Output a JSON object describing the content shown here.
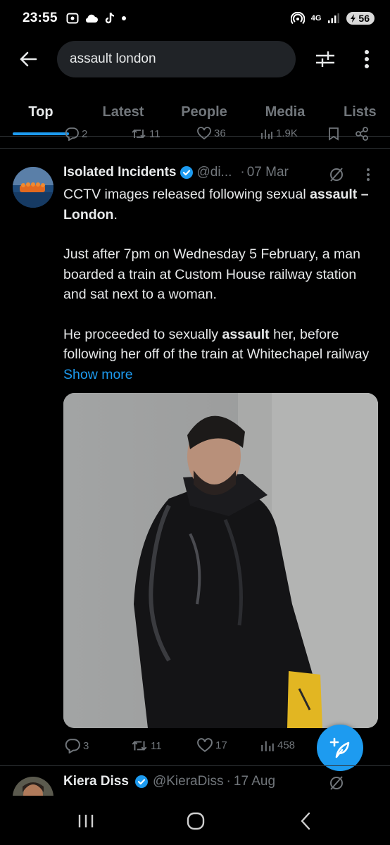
{
  "status_bar": {
    "time": "23:55",
    "network": "4G",
    "battery": "56",
    "left_icons": [
      "screen-record-icon",
      "cloud-icon",
      "tiktok-icon",
      "dot-icon"
    ],
    "right_icons": [
      "hotspot-icon",
      "signal-icon",
      "battery-icon"
    ]
  },
  "header": {
    "search_value": "assault london"
  },
  "tabs": [
    {
      "label": "Top",
      "active": true
    },
    {
      "label": "Latest",
      "active": false
    },
    {
      "label": "People",
      "active": false
    },
    {
      "label": "Media",
      "active": false
    },
    {
      "label": "Lists",
      "active": false
    }
  ],
  "previous_tweet": {
    "replies": "2",
    "reposts": "11",
    "likes": "36",
    "views": "1.9K"
  },
  "tweet": {
    "author_name": "Isolated Incidents",
    "handle": "@di...",
    "separator": "·",
    "date": "07 Mar",
    "verified": true,
    "text_p1_a": "CCTV images released following sexual ",
    "text_p1_b": "assault – London",
    "text_p1_c": ".",
    "text_p2": "Just after 7pm on Wednesday 5 February, a man boarded a train at Custom House railway station and sat next to a woman.",
    "text_p3_a": "He proceeded to sexually ",
    "text_p3_b": "assault",
    "text_p3_c": " her, before following her off of the train at Whitechapel railway ",
    "show_more": "Show more",
    "replies": "3",
    "reposts": "11",
    "likes": "17",
    "views": "458"
  },
  "next_tweet": {
    "author_name": "Kiera Diss",
    "handle": "@KieraDiss",
    "separator": "·",
    "date": "17 Aug",
    "verified": true
  },
  "colors": {
    "background": "#000000",
    "accent": "#1d9bf0",
    "text": "#e7e9ea",
    "muted": "#71767b"
  }
}
